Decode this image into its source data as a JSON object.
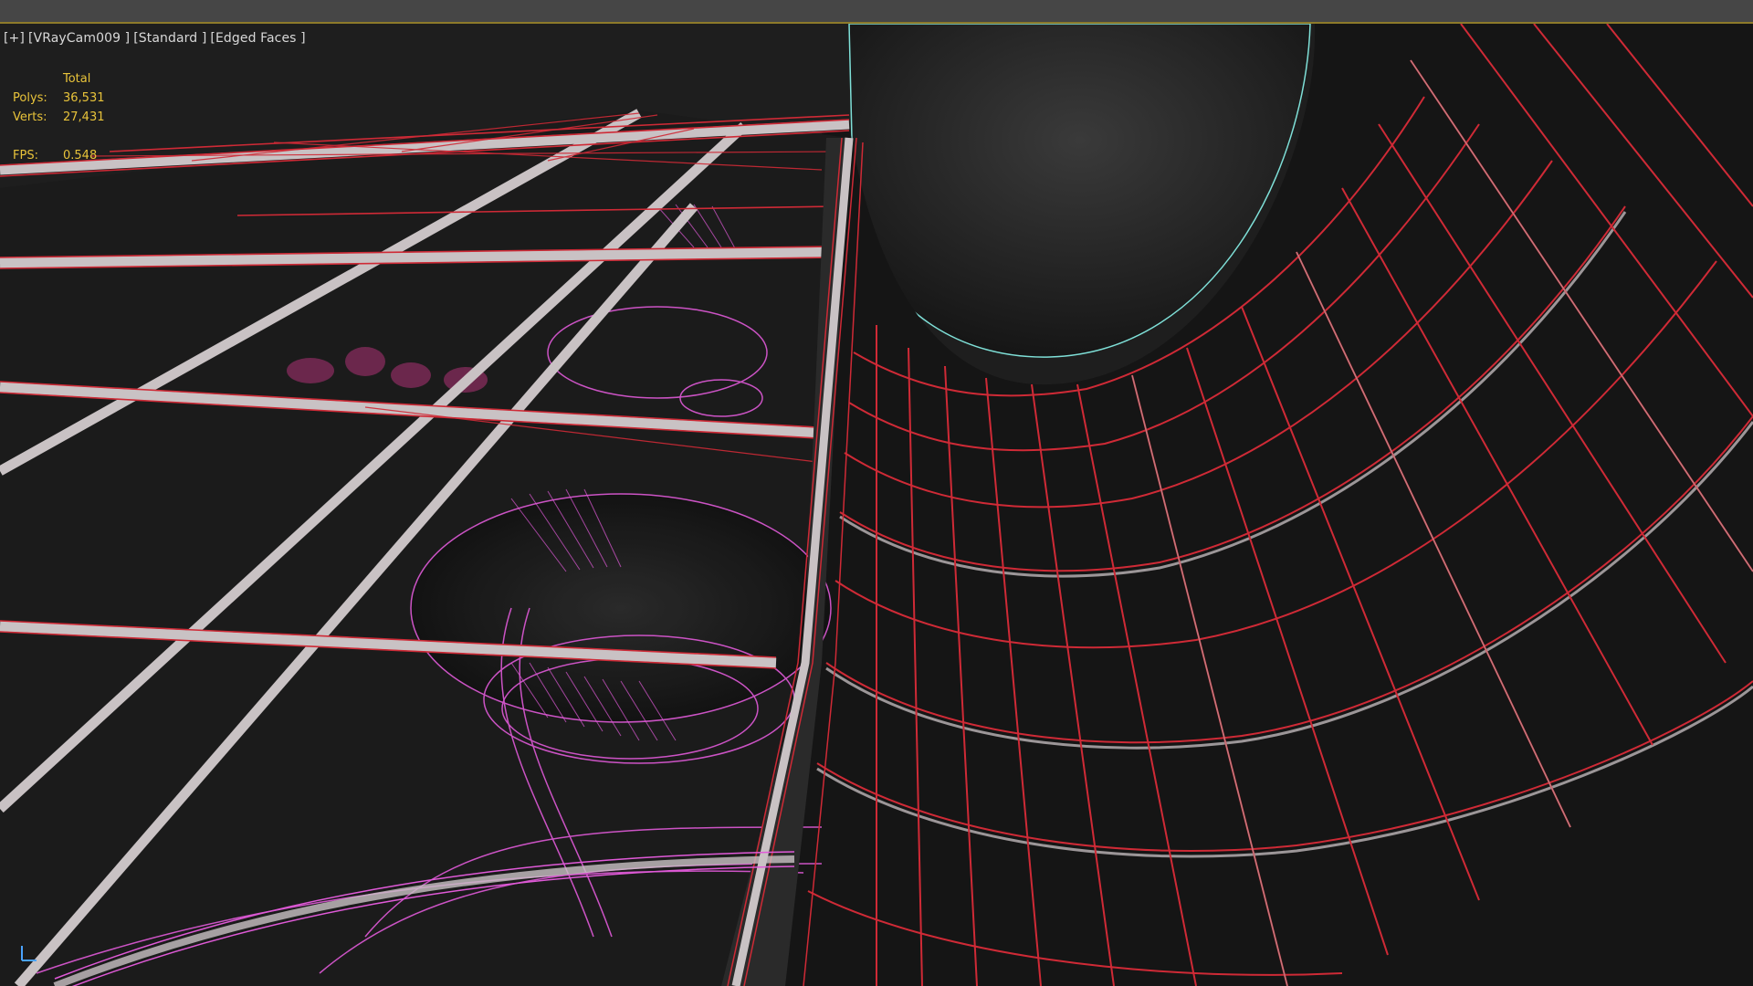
{
  "viewport": {
    "menu": {
      "plus": "[+]",
      "camera": "[VRayCam009 ]",
      "shading": "[Standard ]",
      "display": "[Edged Faces ]"
    }
  },
  "stats": {
    "header": "Total",
    "polys_label": "Polys:",
    "polys_value": "36,531",
    "verts_label": "Verts:",
    "verts_value": "27,431",
    "fps_label": "FPS:",
    "fps_value": "0.548"
  },
  "colors": {
    "background": "#1f1f1f",
    "wireframe_red": "#d0222f",
    "mullion": "#c9c2c4",
    "selection_magenta": "#e05ad8",
    "hud_text": "#e8c33a",
    "label_text": "#d8d8d8",
    "highlight_edge": "#7fe0d8"
  }
}
